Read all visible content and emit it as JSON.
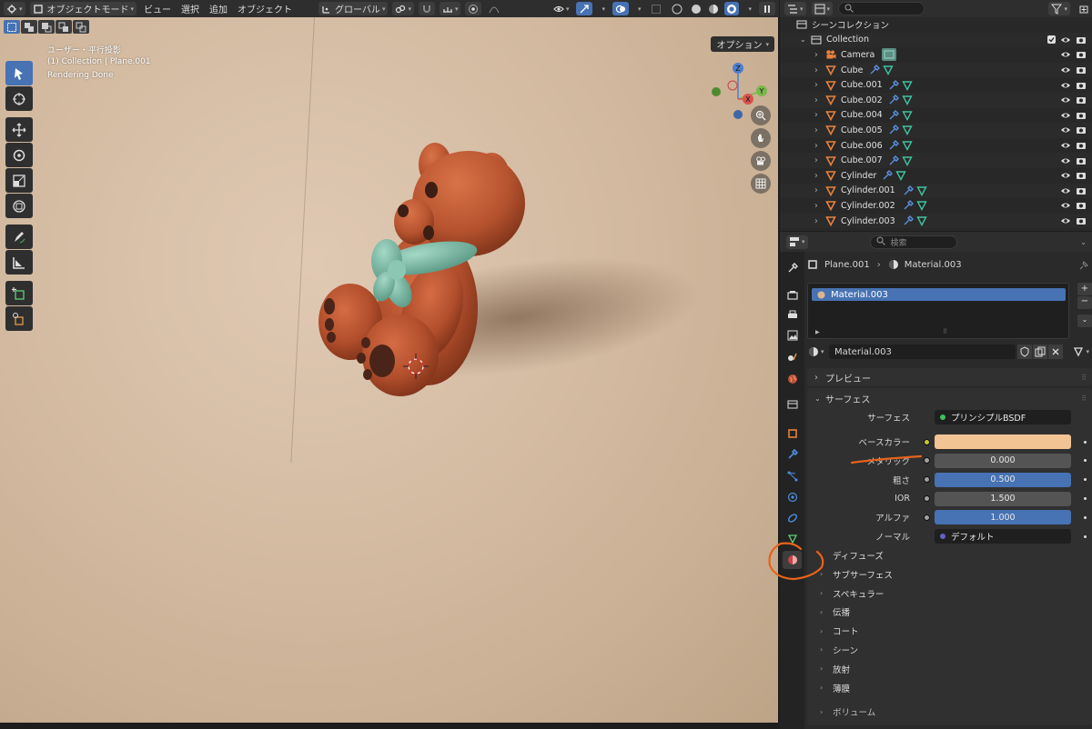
{
  "viewport_header": {
    "mode": "オブジェクトモード",
    "menus": [
      "ビュー",
      "選択",
      "追加",
      "オブジェクト"
    ],
    "transform_orientation": "グローバル"
  },
  "viewport": {
    "overlay": {
      "view_name": "ユーザー・平行投影",
      "collection_info": "(1) Collection | Plane.001",
      "status": "Rendering Done"
    },
    "options_label": "オプション",
    "gizmo": {
      "x": "X",
      "y": "Y",
      "z": "Z"
    }
  },
  "outliner": {
    "scene_collection": "シーンコレクション",
    "collection": "Collection",
    "objects": [
      {
        "name": "Camera",
        "type": "camera"
      },
      {
        "name": "Cube",
        "type": "mesh"
      },
      {
        "name": "Cube.001",
        "type": "mesh"
      },
      {
        "name": "Cube.002",
        "type": "mesh"
      },
      {
        "name": "Cube.004",
        "type": "mesh"
      },
      {
        "name": "Cube.005",
        "type": "mesh"
      },
      {
        "name": "Cube.006",
        "type": "mesh"
      },
      {
        "name": "Cube.007",
        "type": "mesh"
      },
      {
        "name": "Cylinder",
        "type": "mesh"
      },
      {
        "name": "Cylinder.001",
        "type": "mesh"
      },
      {
        "name": "Cylinder.002",
        "type": "mesh"
      },
      {
        "name": "Cylinder.003",
        "type": "mesh"
      }
    ]
  },
  "properties": {
    "search_placeholder": "検索",
    "breadcrumb": {
      "object": "Plane.001",
      "material": "Material.003"
    },
    "slot_name": "Material.003",
    "material_name": "Material.003",
    "panels": {
      "preview": "プレビュー",
      "surface": "サーフェス"
    },
    "surface_rows": [
      {
        "label": "サーフェス",
        "value": "プリンシプルBSDF",
        "kind": "shader"
      },
      {
        "label": "ベースカラー",
        "value": "",
        "kind": "color",
        "color": "#f2c494"
      },
      {
        "label": "メタリック",
        "value": "0.000",
        "kind": "number",
        "fill": 0.0
      },
      {
        "label": "粗さ",
        "value": "0.500",
        "kind": "number",
        "fill": 1.0
      },
      {
        "label": "IOR",
        "value": "1.500",
        "kind": "number",
        "fill": 0.0
      },
      {
        "label": "アルファ",
        "value": "1.000",
        "kind": "number",
        "fill": 1.0
      },
      {
        "label": "ノーマル",
        "value": "デフォルト",
        "kind": "vector"
      }
    ],
    "subpanels": [
      "ディフューズ",
      "サブサーフェス",
      "スペキュラー",
      "伝播",
      "コート",
      "シーン",
      "放射",
      "薄膜",
      "ボリューム"
    ]
  },
  "colors": {
    "accent": "#4772b3",
    "annotation": "#e8621c"
  }
}
